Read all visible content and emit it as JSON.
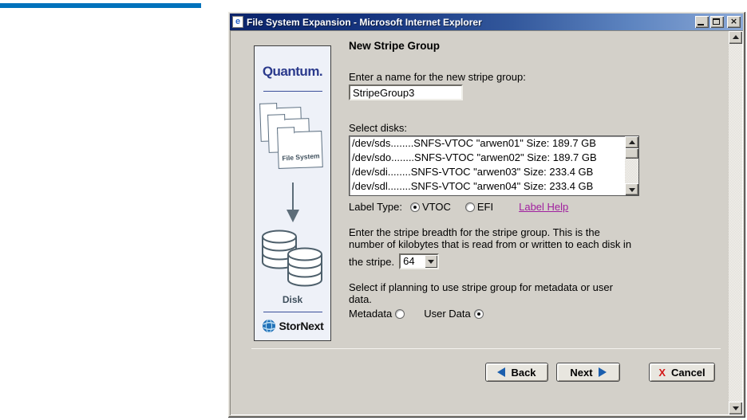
{
  "window": {
    "title": "File System Expansion - Microsoft Internet Explorer",
    "ie_icon_glyph": "e"
  },
  "sidebar": {
    "brand": "Quantum.",
    "file_system_label": "File System",
    "disk_label": "Disk",
    "stornext_label": "StorNext"
  },
  "main": {
    "heading": "New Stripe Group",
    "name_prompt": "Enter a name for the new stripe group:",
    "name_value": "StripeGroup3",
    "disks_label": "Select disks:",
    "disks": [
      "/dev/sds........SNFS-VTOC \"arwen01\" Size: 189.7 GB",
      "/dev/sdo........SNFS-VTOC \"arwen02\" Size: 189.7 GB",
      "/dev/sdi........SNFS-VTOC \"arwen03\" Size: 233.4 GB",
      "/dev/sdl........SNFS-VTOC \"arwen04\" Size: 233.4 GB"
    ],
    "label_type": {
      "label": "Label Type:",
      "vtoc_label": "VTOC",
      "efi_label": "EFI",
      "vtoc_selected": true,
      "efi_selected": false,
      "help_link": "Label Help"
    },
    "breadth_lines": [
      "Enter the stripe breadth for the stripe group. This is the",
      "number of kilobytes that is read from or written to each disk in"
    ],
    "breadth_inline_label": "the stripe.",
    "breadth_value": "64",
    "usage_lines": [
      "Select if planning to use stripe group for metadata or user",
      "data."
    ],
    "metadata_label": "Metadata",
    "userdata_label": "User Data",
    "metadata_selected": false,
    "userdata_selected": true
  },
  "footer": {
    "back_label": "Back",
    "next_label": "Next",
    "cancel_label": "Cancel",
    "cancel_icon": "X"
  },
  "colors": {
    "top_rule_blue": "#0072BC",
    "titlebar_start": "#0B246A",
    "titlebar_end": "#8AA8D6",
    "quantum_blue": "#2B3A8C",
    "sidebar_bg": "#EEF1F8",
    "link_purple": "#A0209F",
    "arrow_blue": "#1B5FAE",
    "cancel_red": "#D41717",
    "content_gray": "#D3D0C9"
  }
}
